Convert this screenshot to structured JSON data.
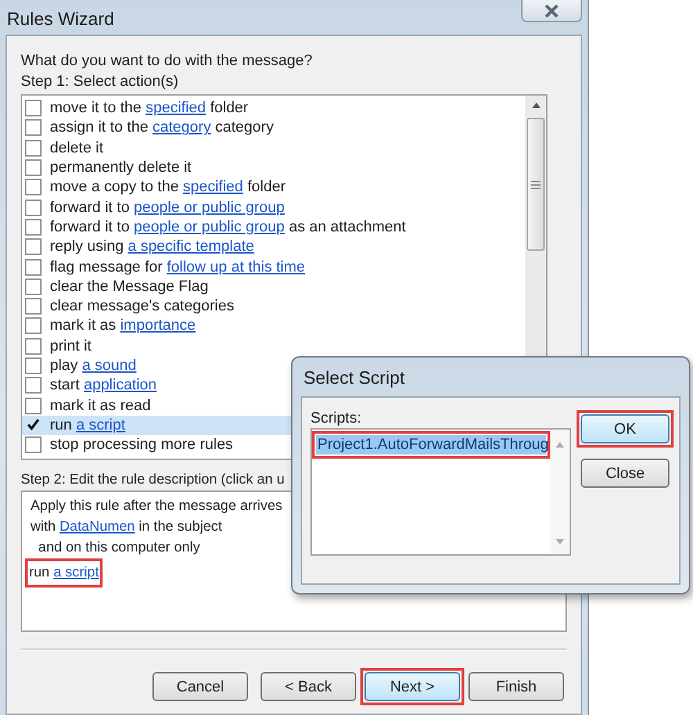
{
  "window": {
    "title": "Rules Wizard"
  },
  "question": "What do you want to do with the message?",
  "step1": {
    "label": "Step 1: Select action(s)"
  },
  "actions": [
    {
      "checked": false,
      "selected": false,
      "parts": [
        {
          "kind": "text",
          "text": "move it to the "
        },
        {
          "kind": "link",
          "text": "specified"
        },
        {
          "kind": "text",
          "text": " folder"
        }
      ]
    },
    {
      "checked": false,
      "selected": false,
      "parts": [
        {
          "kind": "text",
          "text": "assign it to the "
        },
        {
          "kind": "link",
          "text": "category"
        },
        {
          "kind": "text",
          "text": " category"
        }
      ]
    },
    {
      "checked": false,
      "selected": false,
      "parts": [
        {
          "kind": "text",
          "text": "delete it"
        }
      ]
    },
    {
      "checked": false,
      "selected": false,
      "parts": [
        {
          "kind": "text",
          "text": "permanently delete it"
        }
      ]
    },
    {
      "checked": false,
      "selected": false,
      "parts": [
        {
          "kind": "text",
          "text": "move a copy to the "
        },
        {
          "kind": "link",
          "text": "specified"
        },
        {
          "kind": "text",
          "text": " folder"
        }
      ]
    },
    {
      "checked": false,
      "selected": false,
      "parts": [
        {
          "kind": "text",
          "text": "forward it to "
        },
        {
          "kind": "link",
          "text": "people or public group"
        }
      ]
    },
    {
      "checked": false,
      "selected": false,
      "parts": [
        {
          "kind": "text",
          "text": "forward it to "
        },
        {
          "kind": "link",
          "text": "people or public group"
        },
        {
          "kind": "text",
          "text": " as an attachment"
        }
      ]
    },
    {
      "checked": false,
      "selected": false,
      "parts": [
        {
          "kind": "text",
          "text": "reply using "
        },
        {
          "kind": "link",
          "text": "a specific template"
        }
      ]
    },
    {
      "checked": false,
      "selected": false,
      "parts": [
        {
          "kind": "text",
          "text": "flag message for "
        },
        {
          "kind": "link",
          "text": "follow up at this time"
        }
      ]
    },
    {
      "checked": false,
      "selected": false,
      "parts": [
        {
          "kind": "text",
          "text": "clear the Message Flag"
        }
      ]
    },
    {
      "checked": false,
      "selected": false,
      "parts": [
        {
          "kind": "text",
          "text": "clear message's categories"
        }
      ]
    },
    {
      "checked": false,
      "selected": false,
      "parts": [
        {
          "kind": "text",
          "text": "mark it as "
        },
        {
          "kind": "link",
          "text": "importance"
        }
      ]
    },
    {
      "checked": false,
      "selected": false,
      "parts": [
        {
          "kind": "text",
          "text": "print it"
        }
      ]
    },
    {
      "checked": false,
      "selected": false,
      "parts": [
        {
          "kind": "text",
          "text": "play "
        },
        {
          "kind": "link",
          "text": "a sound"
        }
      ]
    },
    {
      "checked": false,
      "selected": false,
      "parts": [
        {
          "kind": "text",
          "text": "start "
        },
        {
          "kind": "link",
          "text": "application"
        }
      ]
    },
    {
      "checked": false,
      "selected": false,
      "parts": [
        {
          "kind": "text",
          "text": "mark it as read"
        }
      ]
    },
    {
      "checked": true,
      "selected": true,
      "parts": [
        {
          "kind": "text",
          "text": "run "
        },
        {
          "kind": "link",
          "text": "a script"
        }
      ]
    },
    {
      "checked": false,
      "selected": false,
      "parts": [
        {
          "kind": "text",
          "text": "stop processing more rules"
        }
      ]
    }
  ],
  "step2": {
    "label": "Step 2: Edit the rule description (click an u"
  },
  "description": [
    {
      "highlighted": false,
      "parts": [
        {
          "kind": "text",
          "text": "Apply this rule after the message arrives"
        }
      ]
    },
    {
      "highlighted": false,
      "parts": [
        {
          "kind": "text",
          "text": "with "
        },
        {
          "kind": "link",
          "text": "DataNumen"
        },
        {
          "kind": "text",
          "text": " in the subject"
        }
      ]
    },
    {
      "highlighted": false,
      "parts": [
        {
          "kind": "text",
          "text": "  and on this computer only"
        }
      ]
    },
    {
      "highlighted": true,
      "parts": [
        {
          "kind": "text",
          "text": "run "
        },
        {
          "kind": "link",
          "text": "a script"
        }
      ]
    }
  ],
  "buttons": [
    {
      "label": "Cancel",
      "default": false,
      "highlighted": false
    },
    {
      "label": "< Back",
      "default": false,
      "highlighted": false
    },
    {
      "label": "Next >",
      "default": true,
      "highlighted": true
    },
    {
      "label": "Finish",
      "default": false,
      "highlighted": false
    }
  ],
  "dialog": {
    "title": "Select Script",
    "list_label": "Scripts:",
    "scripts": [
      {
        "name": "Project1.AutoForwardMailsThroug",
        "selected": true,
        "highlighted": true
      }
    ],
    "buttons": [
      {
        "label": "OK",
        "default": true,
        "highlighted": true
      },
      {
        "label": "Close",
        "default": false,
        "highlighted": false
      }
    ]
  }
}
